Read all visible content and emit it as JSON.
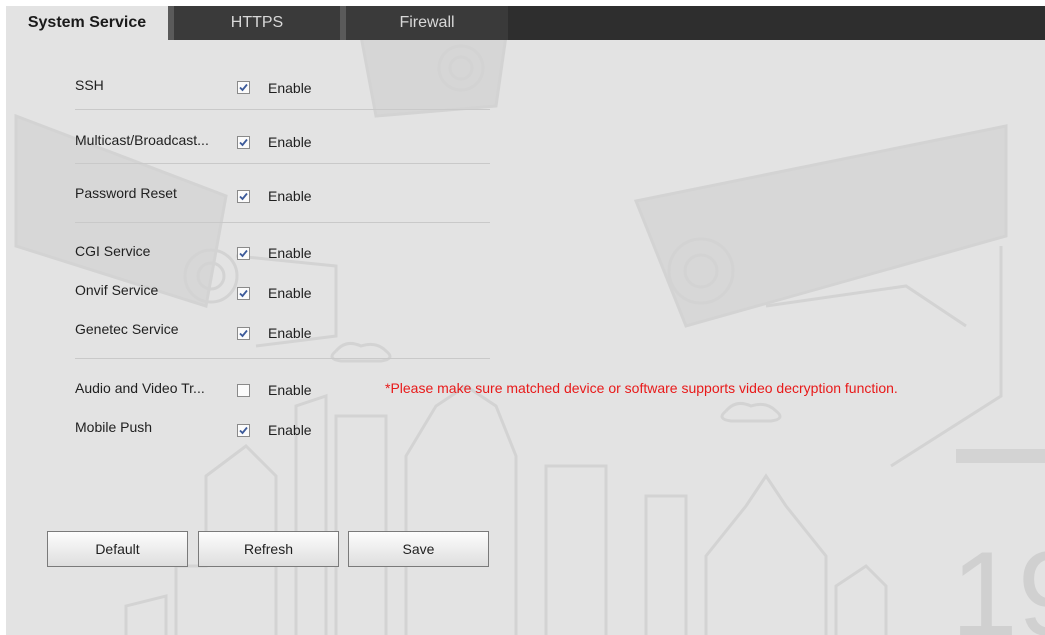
{
  "tabs": [
    {
      "label": "System Service",
      "active": true
    },
    {
      "label": "HTTPS",
      "active": false
    },
    {
      "label": "Firewall",
      "active": false
    }
  ],
  "services": [
    {
      "label": "SSH",
      "checked": true,
      "enable_label": "Enable"
    },
    {
      "label": "Multicast/Broadcast...",
      "checked": true,
      "enable_label": "Enable"
    },
    {
      "label": "Password Reset",
      "checked": true,
      "enable_label": "Enable"
    },
    {
      "label": "CGI Service",
      "checked": true,
      "enable_label": "Enable"
    },
    {
      "label": "Onvif Service",
      "checked": true,
      "enable_label": "Enable"
    },
    {
      "label": "Genetec Service",
      "checked": true,
      "enable_label": "Enable"
    },
    {
      "label": "Audio and Video Tr...",
      "checked": false,
      "enable_label": "Enable"
    },
    {
      "label": "Mobile Push",
      "checked": true,
      "enable_label": "Enable"
    }
  ],
  "warning": "*Please make sure matched device or software supports video decryption function.",
  "buttons": {
    "default_label": "Default",
    "refresh_label": "Refresh",
    "save_label": "Save"
  },
  "colors": {
    "tabbar": "#2e2e2e",
    "panel": "#e3e3e3",
    "warning": "#e81a1a",
    "check": "#3c5a9a"
  }
}
